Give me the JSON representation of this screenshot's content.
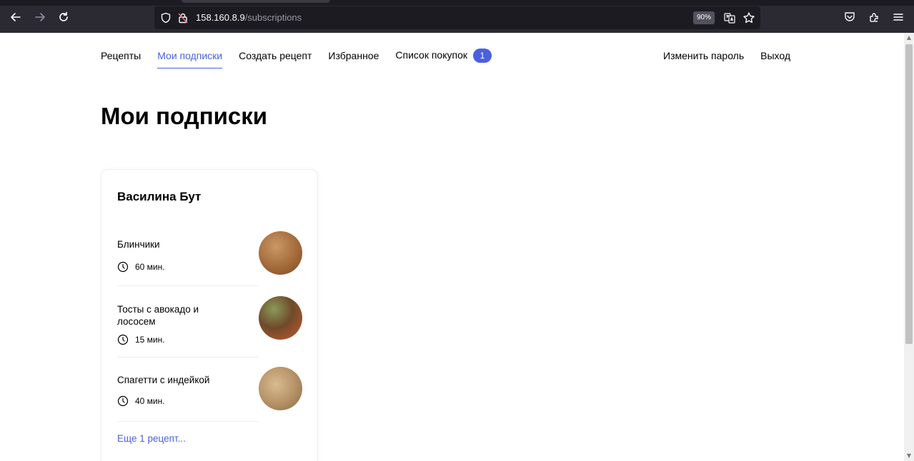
{
  "browser": {
    "url_host": "158.160.8.9",
    "url_path": "/subscriptions",
    "zoom": "90%"
  },
  "nav": {
    "links": [
      {
        "label": "Рецепты"
      },
      {
        "label": "Мои подписки",
        "active": true
      },
      {
        "label": "Создать рецепт"
      },
      {
        "label": "Избранное"
      },
      {
        "label": "Список покупок",
        "badge": "1"
      }
    ],
    "right": {
      "change_password": "Изменить пароль",
      "logout": "Выход"
    }
  },
  "page": {
    "title": "Мои подписки"
  },
  "subscription": {
    "author": "Василина Бут",
    "recipes": [
      {
        "name": "Блинчики",
        "time": "60 мин.",
        "image_color": "#a46a3a"
      },
      {
        "name": "Тосты с авокадо и лососем",
        "time": "15 мин.",
        "image_color": "#6f4a2a"
      },
      {
        "name": "Спагетти с индейкой",
        "time": "40 мин.",
        "image_color": "#b8946a"
      }
    ],
    "more": "Еще 1 рецепт..."
  },
  "colors": {
    "accent": "#4a61dd",
    "browser_chrome": "#2b2a33"
  }
}
